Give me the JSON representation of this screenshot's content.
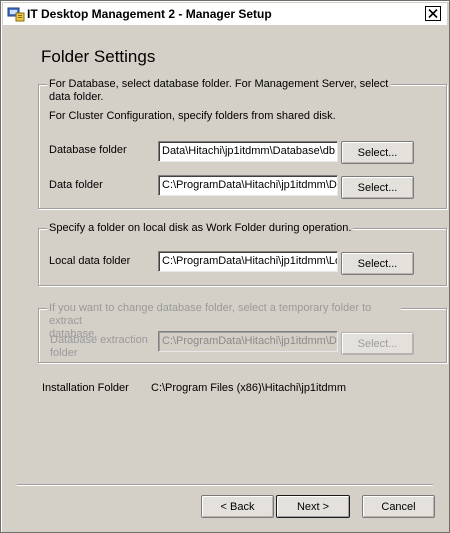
{
  "window": {
    "title": "IT Desktop Management 2 - Manager Setup"
  },
  "page": {
    "title": "Folder Settings"
  },
  "group1": {
    "legend_line1": "For Database, select database folder. For Management Server, select",
    "legend_line2": "data folder.",
    "cluster_note": "For Cluster Configuration, specify folders from shared disk.",
    "database_folder": {
      "label": "Database folder",
      "value": "Data\\Hitachi\\jp1itdmm\\Database\\db",
      "button": "Select..."
    },
    "data_folder": {
      "label": "Data folder",
      "value": "C:\\ProgramData\\Hitachi\\jp1itdmm\\D",
      "button": "Select..."
    }
  },
  "group2": {
    "legend": "Specify a folder on local disk as Work Folder during operation.",
    "local_data_folder": {
      "label": "Local data folder",
      "value": "C:\\ProgramData\\Hitachi\\jp1itdmm\\Lo",
      "button": "Select..."
    }
  },
  "group3": {
    "legend_line1": "If you want to change database folder, select a temporary folder to extract",
    "legend_line2": "database.",
    "extraction_folder": {
      "label_line1": "Database extraction",
      "label_line2": "folder",
      "value": "C:\\ProgramData\\Hitachi\\jp1itdmm\\D",
      "button": "Select..."
    }
  },
  "installation": {
    "label": "Installation Folder",
    "value": "C:\\Program Files (x86)\\Hitachi\\jp1itdmm"
  },
  "footer": {
    "back": "< Back",
    "next": "Next >",
    "cancel": "Cancel"
  },
  "icons": {
    "title": "setup-app-icon",
    "close": "close-icon"
  }
}
